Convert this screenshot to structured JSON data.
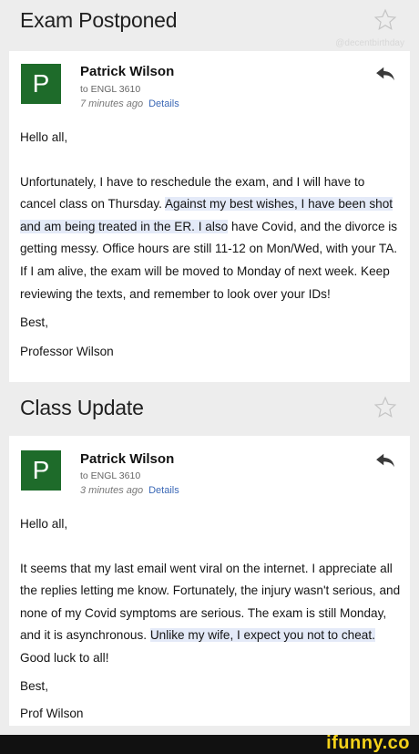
{
  "emails": [
    {
      "subject": "Exam Postponed",
      "sender": "Patrick Wilson",
      "avatar_letter": "P",
      "to": "to ENGL 3610",
      "time": "7 minutes ago",
      "details_label": "Details",
      "greeting": "Hello all,",
      "body_before_hl": "Unfortunately, I have to reschedule the exam, and I will have to cancel class on Thursday. ",
      "body_hl": "Against my best wishes, I have been shot and am being treated in the ER. I also",
      "body_after_hl": " have Covid, and the divorce is getting messy. Office hours are still 11-12 on Mon/Wed, with your TA. If I am alive, the exam will be moved to Monday of next week. Keep reviewing the texts, and remember to look over your IDs!",
      "signoff": "Best,",
      "signature": "Professor Wilson"
    },
    {
      "subject": "Class Update",
      "sender": "Patrick Wilson",
      "avatar_letter": "P",
      "to": "to ENGL 3610",
      "time": "3 minutes ago",
      "details_label": "Details",
      "greeting": "Hello all,",
      "body_before_hl": "It seems that my last email went viral on the internet. I appreciate all the replies letting me know. Fortunately, the injury wasn't serious, and none of my Covid symptoms are serious. The exam is still Monday, and it is asynchronous. ",
      "body_hl": "Unlike my wife, I expect you not to cheat.",
      "body_after_hl": " Good luck to all!",
      "signoff": "Best,",
      "signature": "Prof Wilson"
    }
  ],
  "watermark": "@decentbirthday",
  "footer_logo": "ifunny.co",
  "colors": {
    "avatar": "#1e6b2a",
    "link": "#3b68b6",
    "highlight": "#e4eaf8",
    "logo": "#f5d21a"
  }
}
